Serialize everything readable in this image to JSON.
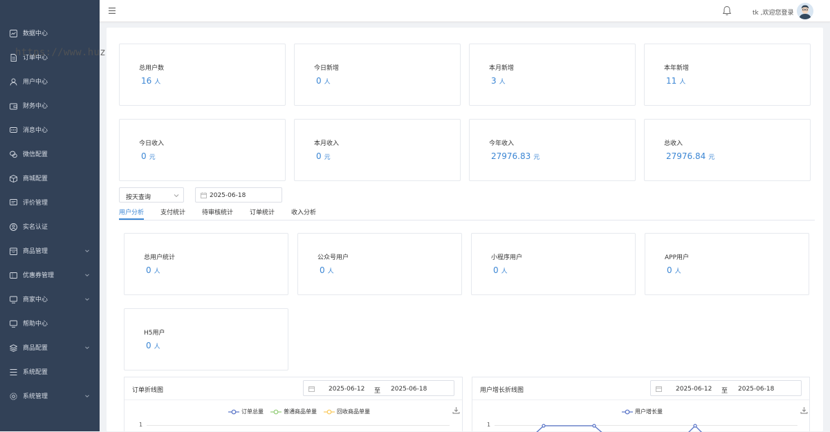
{
  "sidebar": {
    "items": [
      {
        "label": "数据中心",
        "icon": "chart-icon",
        "arrow": false
      },
      {
        "label": "订单中心",
        "icon": "document-icon",
        "arrow": false
      },
      {
        "label": "用户中心",
        "icon": "user-icon",
        "arrow": false
      },
      {
        "label": "财务中心",
        "icon": "wallet-icon",
        "arrow": false
      },
      {
        "label": "消息中心",
        "icon": "message-icon",
        "arrow": false
      },
      {
        "label": "微信配置",
        "icon": "wechat-icon",
        "arrow": false
      },
      {
        "label": "商城配置",
        "icon": "box-icon",
        "arrow": false
      },
      {
        "label": "评价管理",
        "icon": "comment-icon",
        "arrow": false
      },
      {
        "label": "实名认证",
        "icon": "id-icon",
        "arrow": false
      },
      {
        "label": "商品管理",
        "icon": "shop-icon",
        "arrow": true
      },
      {
        "label": "优惠券管理",
        "icon": "coupon-icon",
        "arrow": true
      },
      {
        "label": "商家中心",
        "icon": "monitor-icon",
        "arrow": true
      },
      {
        "label": "帮助中心",
        "icon": "help-monitor-icon",
        "arrow": false
      },
      {
        "label": "商品配置",
        "icon": "layers-icon",
        "arrow": true
      },
      {
        "label": "系统配置",
        "icon": "list-icon",
        "arrow": false
      },
      {
        "label": "系统管理",
        "icon": "gear-icon",
        "arrow": true
      }
    ]
  },
  "watermark": "https://www.huzhan.com/ishop49653",
  "header": {
    "welcome": "tk ,欢迎您登录"
  },
  "stats": {
    "row1": [
      {
        "label": "总用户数",
        "value": "16",
        "unit": "人"
      },
      {
        "label": "今日新增",
        "value": "0",
        "unit": "人"
      },
      {
        "label": "本月新增",
        "value": "3",
        "unit": "人"
      },
      {
        "label": "本年新增",
        "value": "11",
        "unit": "人"
      }
    ],
    "row2": [
      {
        "label": "今日收入",
        "value": "0",
        "unit": "元"
      },
      {
        "label": "本月收入",
        "value": "0",
        "unit": "元"
      },
      {
        "label": "今年收入",
        "value": "27976.83",
        "unit": "元"
      },
      {
        "label": "总收入",
        "value": "27976.84",
        "unit": "元"
      }
    ]
  },
  "filter": {
    "mode": "按天查询",
    "date": "2025-06-18"
  },
  "tabs": [
    {
      "label": "用户分析",
      "active": true
    },
    {
      "label": "支付统计",
      "active": false
    },
    {
      "label": "待审核统计",
      "active": false
    },
    {
      "label": "订单统计",
      "active": false
    },
    {
      "label": "收入分析",
      "active": false
    }
  ],
  "user_stats": [
    {
      "label": "总用户统计",
      "value": "0",
      "unit": "人"
    },
    {
      "label": "公众号用户",
      "value": "0",
      "unit": "人"
    },
    {
      "label": "小程序用户",
      "value": "0",
      "unit": "人"
    },
    {
      "label": "APP用户",
      "value": "0",
      "unit": "人"
    },
    {
      "label": "H5用户",
      "value": "0",
      "unit": "人"
    }
  ],
  "charts": {
    "order": {
      "title": "订单折线图",
      "start": "2025-06-12",
      "sep": "至",
      "end": "2025-06-18",
      "legend": [
        {
          "name": "订单总量",
          "color": "#5470c6"
        },
        {
          "name": "普通商品单量",
          "color": "#91cc75"
        },
        {
          "name": "回收商品单量",
          "color": "#fac858"
        }
      ],
      "y_tick": "1"
    },
    "user": {
      "title": "用户增长折线图",
      "start": "2025-06-12",
      "sep": "至",
      "end": "2025-06-18",
      "legend": [
        {
          "name": "用户增长量",
          "color": "#5470c6"
        }
      ],
      "y_tick": "1"
    }
  },
  "colors": {
    "sidebar_bg": "#324157",
    "accent": "#3b86d4"
  }
}
